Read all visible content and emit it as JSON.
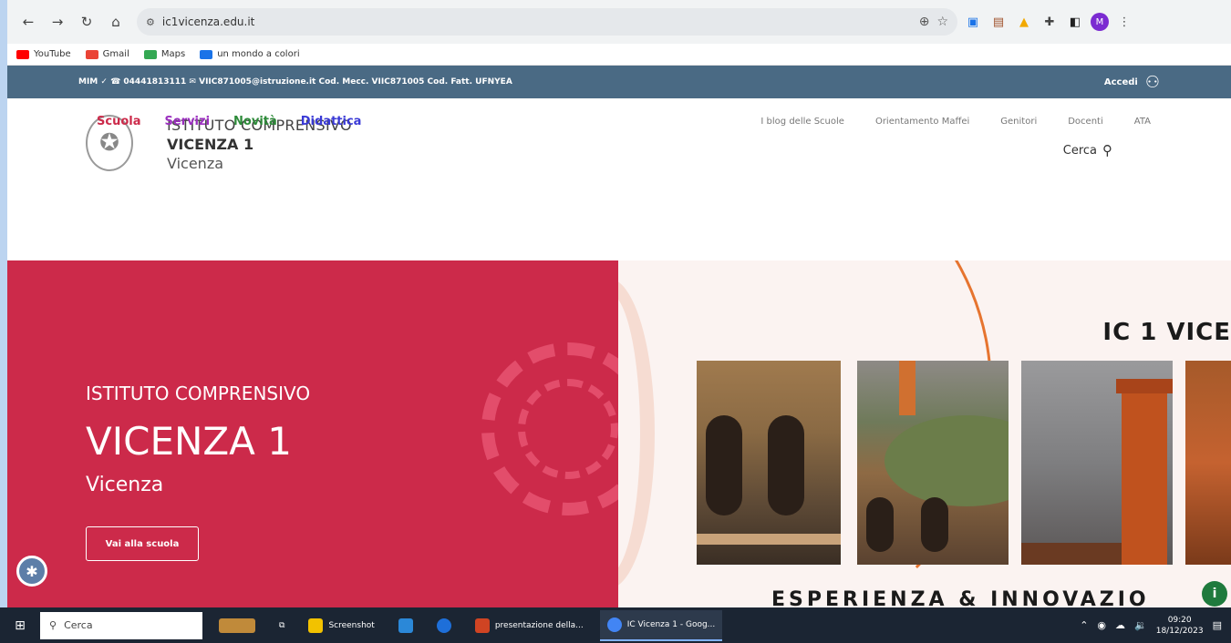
{
  "browser": {
    "url": "ic1vicenza.edu.it",
    "bookmarks": [
      {
        "label": "YouTube",
        "color": "#ff0000"
      },
      {
        "label": "Gmail",
        "color": "#ea4335"
      },
      {
        "label": "Maps",
        "color": "#34a853"
      },
      {
        "label": "un mondo a colori",
        "color": "#1a73e8"
      }
    ],
    "profile_initial": "M"
  },
  "site": {
    "topbar": {
      "contacts": "MIM ✓ ☎ 04441813111 ✉ VIIC871005@istruzione.it Cod. Mecc. VIIC871005 Cod. Fatt. UFNYEA",
      "login": "Accedi"
    },
    "header": {
      "line1": "ISTITUTO COMPRENSIVO",
      "line2": "VICENZA 1",
      "line3": "Vicenza",
      "search_label": "Cerca"
    },
    "nav": [
      {
        "label": "Scuola",
        "color": "#cc2a4a"
      },
      {
        "label": "Servizi",
        "color": "#9b2fbf"
      },
      {
        "label": "Novità",
        "color": "#2e8b3a"
      },
      {
        "label": "Didattica",
        "color": "#3a3ad6"
      }
    ],
    "subnav": [
      "I blog delle Scuole",
      "Orientamento Maffei",
      "Genitori",
      "Docenti",
      "ATA"
    ],
    "hero": {
      "kicker": "ISTITUTO COMPRENSIVO",
      "title": "VICENZA 1",
      "subtitle": "Vicenza",
      "button": "Vai alla scuola",
      "right_title": "IC 1 VICE",
      "slogan": "ESPERIENZA & INNOVAZIO"
    }
  },
  "taskbar": {
    "search_placeholder": "Cerca",
    "apps": [
      {
        "label": "Screenshot",
        "color": "#f2c200"
      },
      {
        "label": "",
        "color": "#2b88d8"
      },
      {
        "label": "",
        "color": "#1e6fd9"
      },
      {
        "label": "presentazione della...",
        "color": "#d04423"
      },
      {
        "label": "IC Vicenza 1 - Goog...",
        "color": "#4285f4"
      }
    ],
    "time": "09:20",
    "date": "18/12/2023"
  },
  "colors": {
    "topbar": "#4a6a84",
    "hero_red": "#cc2a4a",
    "accent_orange": "#e6742f"
  }
}
